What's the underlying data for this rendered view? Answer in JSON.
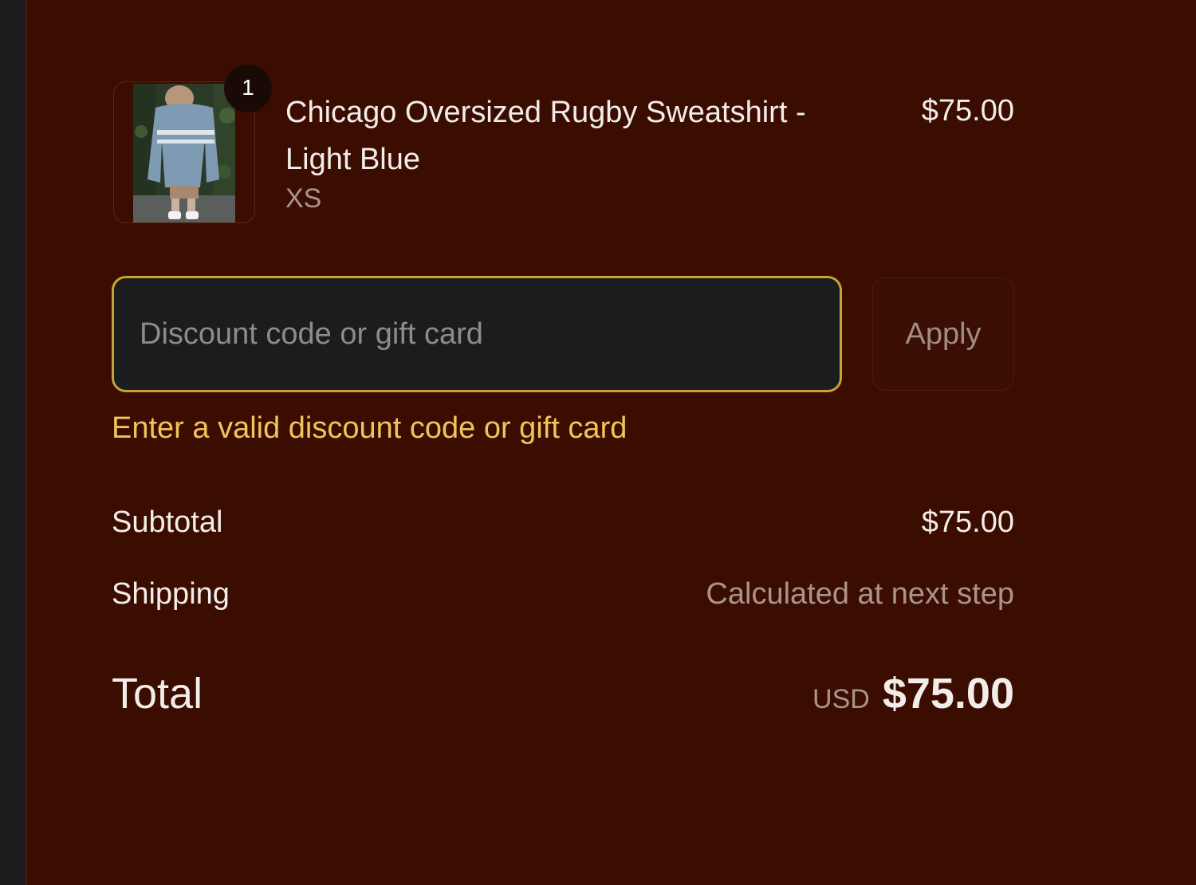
{
  "product": {
    "quantity": "1",
    "title": "Chicago Oversized Rugby Sweatshirt - Light Blue",
    "variant": "XS",
    "price": "$75.00",
    "image_icon": "product-photo-sweatshirt"
  },
  "discount": {
    "placeholder": "Discount code or gift card",
    "value": "",
    "apply_label": "Apply",
    "error": "Enter a valid discount code or gift card"
  },
  "totals": {
    "subtotal_label": "Subtotal",
    "subtotal_value": "$75.00",
    "shipping_label": "Shipping",
    "shipping_value": "Calculated at next step",
    "total_label": "Total",
    "currency": "USD",
    "total_value": "$75.00"
  },
  "colors": {
    "background": "#3b0d00",
    "input_border_focus": "#c7a336",
    "error": "#f0c45a"
  }
}
